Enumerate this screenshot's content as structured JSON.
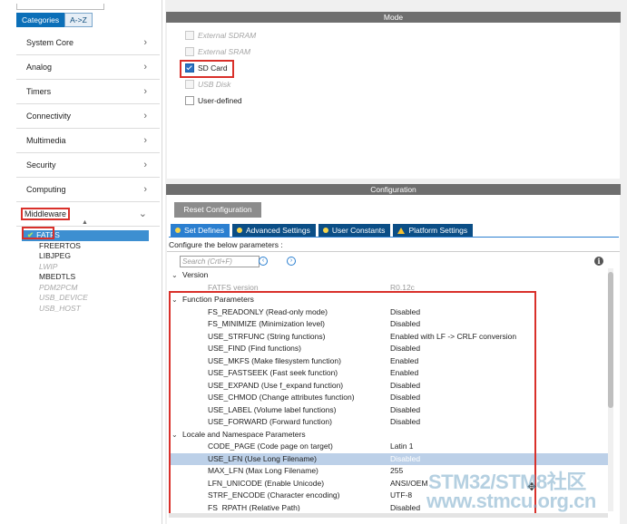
{
  "left": {
    "category_tabs": [
      "Categories",
      "A->Z"
    ],
    "categories": [
      {
        "label": "System Core",
        "chevron": ">"
      },
      {
        "label": "Analog",
        "chevron": ">"
      },
      {
        "label": "Timers",
        "chevron": ">"
      },
      {
        "label": "Connectivity",
        "chevron": ">"
      },
      {
        "label": "Multimedia",
        "chevron": ">"
      },
      {
        "label": "Security",
        "chevron": ">"
      },
      {
        "label": "Computing",
        "chevron": ">"
      },
      {
        "label": "Middleware",
        "chevron": "v"
      }
    ],
    "middleware_items": [
      {
        "label": "FATFS",
        "state": "selected"
      },
      {
        "label": "FREERTOS",
        "state": "enabled"
      },
      {
        "label": "LIBJPEG",
        "state": "enabled"
      },
      {
        "label": "LWIP",
        "state": "disabled"
      },
      {
        "label": "MBEDTLS",
        "state": "enabled"
      },
      {
        "label": "PDM2PCM",
        "state": "disabled"
      },
      {
        "label": "USB_DEVICE",
        "state": "disabled"
      },
      {
        "label": "USB_HOST",
        "state": "disabled"
      }
    ]
  },
  "mode": {
    "title": "Mode",
    "options": [
      {
        "label": "External SDRAM",
        "checked": false,
        "disabled": true
      },
      {
        "label": "External SRAM",
        "checked": false,
        "disabled": true
      },
      {
        "label": "SD Card",
        "checked": true,
        "disabled": false
      },
      {
        "label": "USB Disk",
        "checked": false,
        "disabled": true
      },
      {
        "label": "User-defined",
        "checked": false,
        "disabled": false
      }
    ]
  },
  "configuration": {
    "title": "Configuration",
    "reset_button": "Reset Configuration",
    "tabs": [
      "Set Defines",
      "Advanced Settings",
      "User Constants",
      "Platform Settings"
    ],
    "description": "Configure the below parameters :",
    "search_placeholder": "Search (Crtl+F)",
    "rows": [
      {
        "type": "group",
        "name": "Version"
      },
      {
        "type": "param",
        "name": "FATFS version",
        "value": "R0.12c",
        "dim": true
      },
      {
        "type": "group",
        "name": "Function Parameters"
      },
      {
        "type": "param",
        "name": "FS_READONLY (Read-only mode)",
        "value": "Disabled"
      },
      {
        "type": "param",
        "name": "FS_MINIMIZE (Minimization level)",
        "value": "Disabled"
      },
      {
        "type": "param",
        "name": "USE_STRFUNC (String functions)",
        "value": "Enabled with LF -> CRLF conversion"
      },
      {
        "type": "param",
        "name": "USE_FIND (Find functions)",
        "value": "Disabled"
      },
      {
        "type": "param",
        "name": "USE_MKFS (Make filesystem function)",
        "value": "Enabled"
      },
      {
        "type": "param",
        "name": "USE_FASTSEEK (Fast seek function)",
        "value": "Enabled"
      },
      {
        "type": "param",
        "name": "USE_EXPAND (Use f_expand function)",
        "value": "Disabled"
      },
      {
        "type": "param",
        "name": "USE_CHMOD (Change attributes function)",
        "value": "Disabled"
      },
      {
        "type": "param",
        "name": "USE_LABEL (Volume label functions)",
        "value": "Disabled"
      },
      {
        "type": "param",
        "name": "USE_FORWARD (Forward function)",
        "value": "Disabled"
      },
      {
        "type": "group",
        "name": "Locale and Namespace Parameters"
      },
      {
        "type": "param",
        "name": "CODE_PAGE (Code page on target)",
        "value": "Latin 1"
      },
      {
        "type": "param",
        "name": "USE_LFN (Use Long Filename)",
        "value": "Disabled",
        "selected": true
      },
      {
        "type": "param",
        "name": "MAX_LFN (Max Long Filename)",
        "value": "255"
      },
      {
        "type": "param",
        "name": "LFN_UNICODE (Enable Unicode)",
        "value": "ANSI/OEM"
      },
      {
        "type": "param",
        "name": "STRF_ENCODE (Character encoding)",
        "value": "UTF-8"
      },
      {
        "type": "param",
        "name": "FS_RPATH (Relative Path)",
        "value": "Disabled"
      }
    ]
  },
  "watermark": {
    "line1": "STM32/STM8社区",
    "line2": "www.stmcu.org.cn"
  }
}
